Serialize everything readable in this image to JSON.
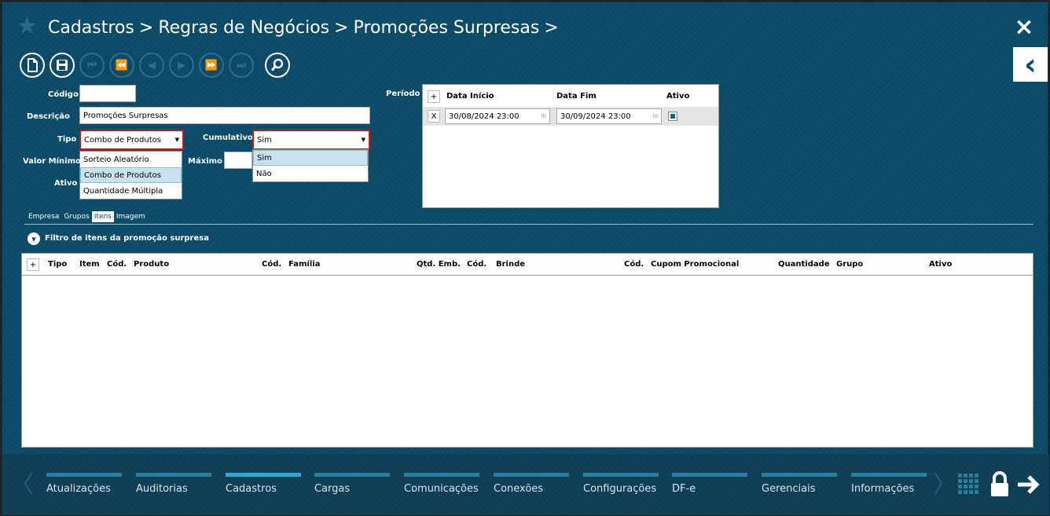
{
  "header": {
    "breadcrumbs": [
      "Cadastros",
      "Regras de Negócios",
      "Promoções Surpresas"
    ],
    "sep": ">"
  },
  "icons": {
    "close": "×",
    "back": "‹",
    "star": "★",
    "new": "🗋",
    "save": "💾",
    "first": "⏮",
    "prev_page": "⏪",
    "prev": "◀",
    "next": "▶",
    "next_page": "⏩",
    "last": "⏭",
    "search": "⌕",
    "grid": "▦",
    "lock": "🔒",
    "arrow": "➔",
    "left_chev": "〈",
    "right_chev": "〉",
    "dropdown_arrow": "▼",
    "expand": "▾",
    "calendar": "⁝⁝⁝",
    "checkbox_checked": "■"
  },
  "form": {
    "codigo_label": "Código",
    "codigo_value": "",
    "descricao_label": "Descrição",
    "descricao_value": "Promoções Surpresas",
    "tipo_label": "Tipo",
    "tipo_value": "Combo de Produtos",
    "tipo_options": [
      "Sorteio Aleatório",
      "Combo de Produtos",
      "Quantidade Múltipla"
    ],
    "cumulativo_label": "Cumulativo",
    "cumulativo_value": "Sim",
    "cumulativo_options": [
      "Sim",
      "Não"
    ],
    "valor_minimo_label": "Valor Mínimo",
    "maximo_label": "Máximo",
    "ativo_label": "Ativo",
    "periodo_label": "Período"
  },
  "periodo": {
    "add": "+",
    "headers": [
      "Data Início",
      "Data Fim",
      "Ativo"
    ],
    "row": {
      "remove": "X",
      "inicio": "30/08/2024 23:00",
      "fim": "30/09/2024 23:00",
      "ativo": true
    }
  },
  "tabs": [
    {
      "label": "Empresa",
      "active": false
    },
    {
      "label": "Grupos",
      "active": false
    },
    {
      "label": "Itens",
      "active": true
    },
    {
      "label": "Imagem",
      "active": false
    }
  ],
  "filter": {
    "label": "Filtro de itens da promoção surpresa"
  },
  "items_table": {
    "add": "+",
    "columns": [
      "Tipo",
      "Item",
      "Cód.",
      "Produto",
      "Cód.",
      "Família",
      "Qtd. Emb.",
      "Cód.",
      "Brinde",
      "Cód.",
      "Cupom Promocional",
      "Quantidade",
      "Grupo",
      "Ativo"
    ]
  },
  "modules": [
    {
      "label": "Atualizações",
      "active": false
    },
    {
      "label": "Auditorias",
      "active": false
    },
    {
      "label": "Cadastros",
      "active": true
    },
    {
      "label": "Cargas",
      "active": false
    },
    {
      "label": "Comunicações",
      "active": false
    },
    {
      "label": "Conexões",
      "active": false
    },
    {
      "label": "Configurações",
      "active": false
    },
    {
      "label": "DF-e",
      "active": false
    },
    {
      "label": "Gerenciais",
      "active": false
    },
    {
      "label": "Informações",
      "active": false
    }
  ]
}
